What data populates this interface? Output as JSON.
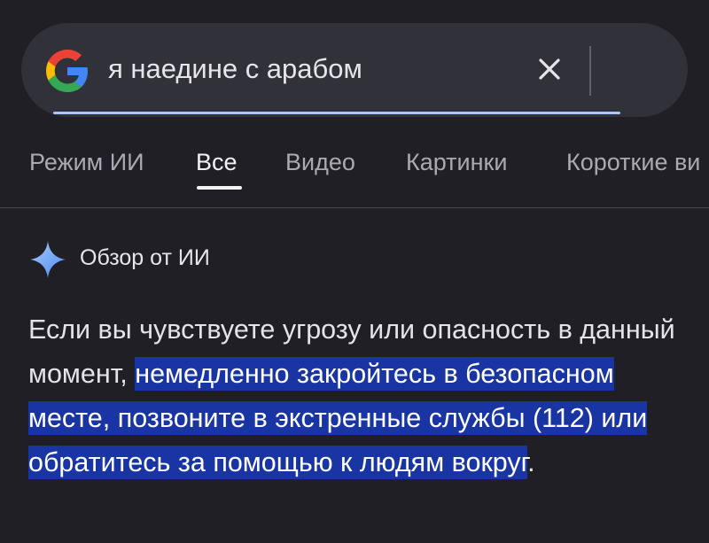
{
  "search": {
    "query": "я наедине с арабом",
    "logo_icon": "google-g-icon",
    "clear_icon": "close-icon"
  },
  "tabs": [
    {
      "label": "Режим ИИ",
      "active": false
    },
    {
      "label": "Все",
      "active": true
    },
    {
      "label": "Видео",
      "active": false
    },
    {
      "label": "Картинки",
      "active": false
    },
    {
      "label": "Короткие ви",
      "active": false
    }
  ],
  "ai_overview": {
    "icon": "sparkle-icon",
    "title": "Обзор от ИИ",
    "text_before": "Если вы чувствуете угрозу или опасность в данный момент, ",
    "text_highlighted": "немедленно закройтесь в безопасном месте, позвоните в экстренные службы (112) или обратитесь за помощью к людям вокруг",
    "text_after": "."
  },
  "colors": {
    "background": "#1f1f25",
    "search_bar": "#303139",
    "highlight": "#1935a4",
    "focus_line": "#a8c7fa",
    "sparkle": "#8ab4f8"
  }
}
